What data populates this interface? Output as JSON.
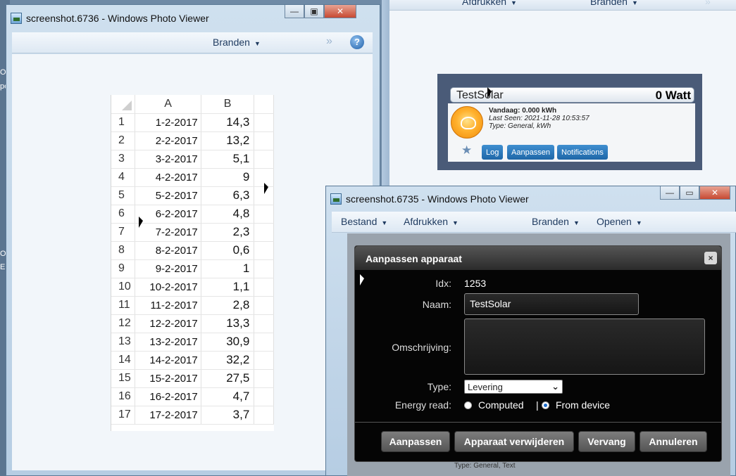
{
  "desktop": {
    "left_text": [
      "OL",
      "pe",
      "OL",
      "E"
    ]
  },
  "window_left": {
    "title": "screenshot.6736 - Windows Photo Viewer",
    "ctrl_min": "—",
    "ctrl_max": "▣",
    "ctrl_close": "✕",
    "toolbar": {
      "burn_label": "Branden",
      "more_label": "»",
      "help_label": "?"
    }
  },
  "spreadsheet": {
    "columns": [
      "A",
      "B"
    ],
    "rows": [
      {
        "n": "1",
        "a": "1-2-2017",
        "b": "14,3"
      },
      {
        "n": "2",
        "a": "2-2-2017",
        "b": "13,2"
      },
      {
        "n": "3",
        "a": "3-2-2017",
        "b": "5,1"
      },
      {
        "n": "4",
        "a": "4-2-2017",
        "b": "9"
      },
      {
        "n": "5",
        "a": "5-2-2017",
        "b": "6,3"
      },
      {
        "n": "6",
        "a": "6-2-2017",
        "b": "4,8"
      },
      {
        "n": "7",
        "a": "7-2-2017",
        "b": "2,3"
      },
      {
        "n": "8",
        "a": "8-2-2017",
        "b": "0,6"
      },
      {
        "n": "9",
        "a": "9-2-2017",
        "b": "1"
      },
      {
        "n": "10",
        "a": "10-2-2017",
        "b": "1,1"
      },
      {
        "n": "11",
        "a": "11-2-2017",
        "b": "2,8"
      },
      {
        "n": "12",
        "a": "12-2-2017",
        "b": "13,3"
      },
      {
        "n": "13",
        "a": "13-2-2017",
        "b": "30,9"
      },
      {
        "n": "14",
        "a": "14-2-2017",
        "b": "32,2"
      },
      {
        "n": "15",
        "a": "15-2-2017",
        "b": "27,5"
      },
      {
        "n": "16",
        "a": "16-2-2017",
        "b": "4,7"
      },
      {
        "n": "17",
        "a": "17-2-2017",
        "b": "3,7"
      }
    ]
  },
  "window_right_bg": {
    "toolbar": {
      "print_label": "Afdrukken",
      "burn_label": "Branden",
      "more_label": "»"
    }
  },
  "device_card": {
    "name": "TestSolar",
    "power": "0 Watt",
    "today_label": "Vandaag:",
    "today_value": "0.000 kWh",
    "last_seen": "Last Seen: 2021-11-28 10:53:57",
    "type_line": "Type: General, kWh",
    "buttons": {
      "log": "Log",
      "edit": "Aanpassen",
      "notifications": "Notifications"
    }
  },
  "window_front": {
    "title": "screenshot.6735 - Windows Photo Viewer",
    "ctrl_min": "—",
    "ctrl_max": "▭",
    "ctrl_close": "✕",
    "toolbar": {
      "file_label": "Bestand",
      "print_label": "Afdrukken",
      "burn_label": "Branden",
      "open_label": "Openen"
    },
    "bottom_peek": "Type: General, Text"
  },
  "dialog": {
    "title": "Aanpassen apparaat",
    "close": "×",
    "idx_label": "Idx:",
    "idx_value": "1253",
    "name_label": "Naam:",
    "name_value": "TestSolar",
    "desc_label": "Omschrijving:",
    "desc_value": "",
    "type_label": "Type:",
    "type_value": "Levering",
    "energy_label": "Energy read:",
    "radio_computed": "Computed",
    "radio_sep": "|",
    "radio_device": "From device",
    "buttons": {
      "save": "Aanpassen",
      "delete": "Apparaat verwijderen",
      "replace": "Vervang",
      "cancel": "Annuleren"
    }
  }
}
